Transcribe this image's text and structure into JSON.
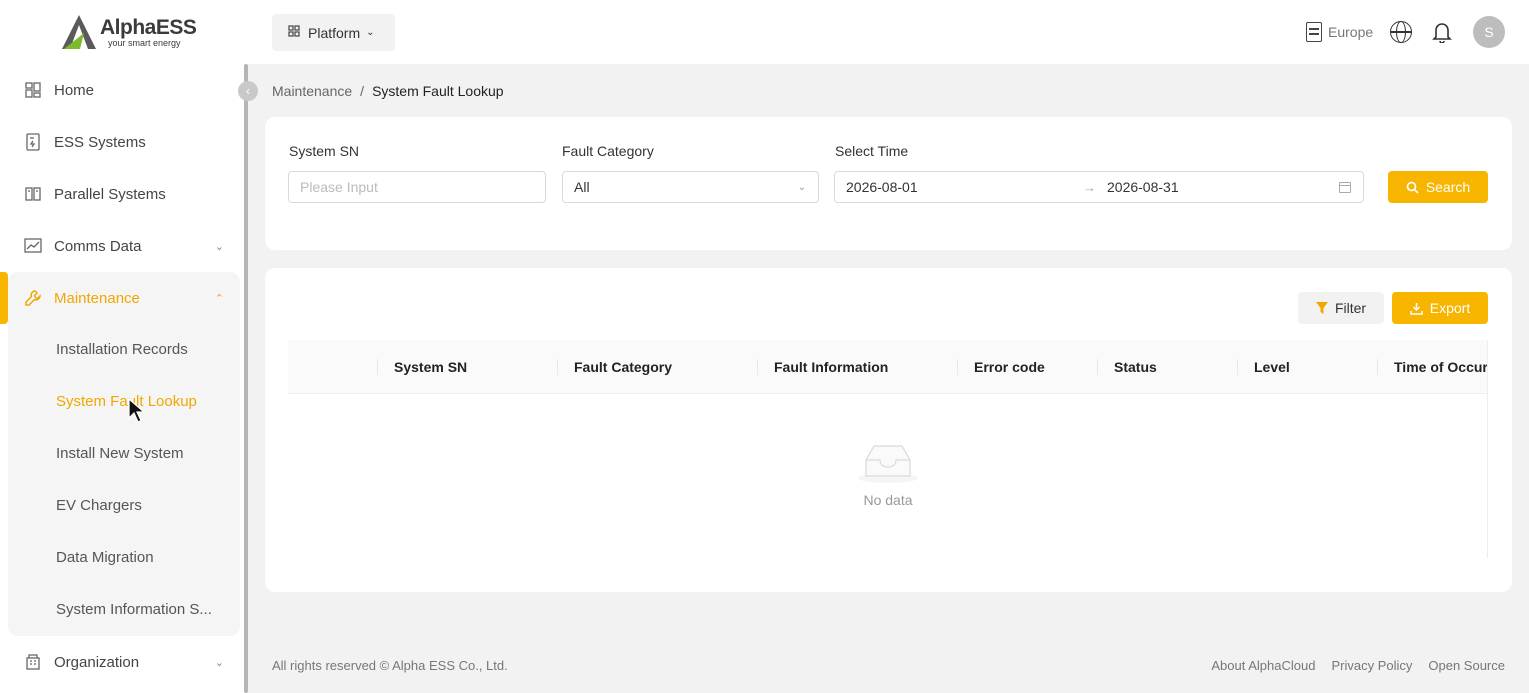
{
  "brand": {
    "name": "AlphaESS",
    "tagline": "your smart energy"
  },
  "sidebar": {
    "items": [
      {
        "label": "Home",
        "icon": "dashboard-icon"
      },
      {
        "label": "ESS Systems",
        "icon": "system-icon"
      },
      {
        "label": "Parallel Systems",
        "icon": "parallel-icon"
      },
      {
        "label": "Comms Data",
        "icon": "chart-icon"
      },
      {
        "label": "Maintenance",
        "icon": "wrench-icon"
      },
      {
        "label": "Organization",
        "icon": "building-icon"
      }
    ],
    "maintenance_subitems": [
      "Installation Records",
      "System Fault Lookup",
      "Install New System",
      "EV Chargers",
      "Data Migration",
      "System Information S..."
    ]
  },
  "header": {
    "platform_label": "Platform",
    "region_label": "Europe",
    "avatar_initial": "S"
  },
  "breadcrumb": {
    "parent": "Maintenance",
    "separator": "/",
    "current": "System Fault Lookup"
  },
  "search_form": {
    "system_sn_label": "System SN",
    "system_sn_placeholder": "Please Input",
    "fault_category_label": "Fault Category",
    "fault_category_value": "All",
    "select_time_label": "Select Time",
    "date_start": "2026-08-01",
    "date_end": "2026-08-31",
    "search_label": "Search"
  },
  "table": {
    "filter_label": "Filter",
    "export_label": "Export",
    "columns": [
      "System SN",
      "Fault Category",
      "Fault Information",
      "Error code",
      "Status",
      "Level",
      "Time of Occurr"
    ],
    "empty_text": "No data"
  },
  "footer": {
    "copyright": "All rights reserved © Alpha ESS Co., Ltd.",
    "links": [
      "About AlphaCloud",
      "Privacy Policy",
      "Open Source"
    ]
  },
  "colors": {
    "accent": "#f7b500",
    "active_text": "#f0a800"
  }
}
